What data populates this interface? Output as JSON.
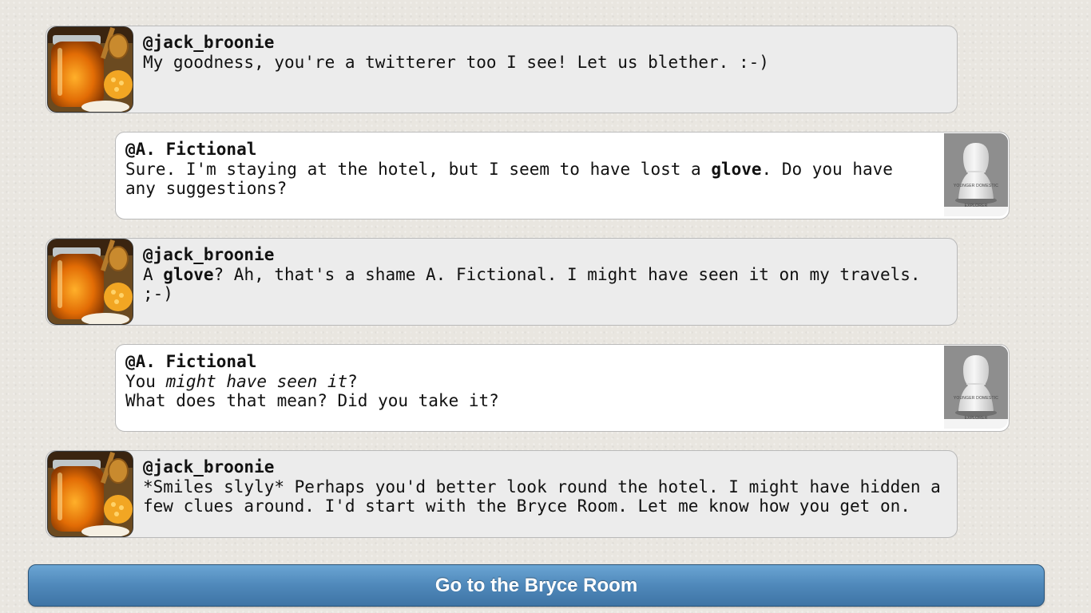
{
  "conversation": [
    {
      "role": "npc",
      "handle": "@jack_broonie",
      "avatar_icon": "honey-jar-avatar-icon",
      "lines": [
        [
          {
            "text": "My goodness, you're a twitterer too I see! Let us blether. :-)"
          }
        ]
      ]
    },
    {
      "role": "player",
      "handle": "@A. Fictional",
      "avatar_icon": "pawn-figure-avatar-icon",
      "avatar_caption": "YOUNGER DOMESTIC EXPLORER",
      "lines": [
        [
          {
            "text": "Sure. I'm staying at the hotel, but I seem to have lost a "
          },
          {
            "text": "glove",
            "style": "bold"
          },
          {
            "text": ". Do you have any suggestions?"
          }
        ]
      ]
    },
    {
      "role": "npc",
      "handle": "@jack_broonie",
      "avatar_icon": "honey-jar-avatar-icon",
      "lines": [
        [
          {
            "text": "A "
          },
          {
            "text": "glove",
            "style": "bold"
          },
          {
            "text": "? Ah, that's a shame A. Fictional. I might have seen it on my travels. ;-)"
          }
        ]
      ]
    },
    {
      "role": "player",
      "handle": "@A. Fictional",
      "avatar_icon": "pawn-figure-avatar-icon",
      "avatar_caption": "YOUNGER DOMESTIC EXPLORER",
      "lines": [
        [
          {
            "text": "You "
          },
          {
            "text": "might have seen it",
            "style": "italic"
          },
          {
            "text": "?"
          }
        ],
        [
          {
            "text": "What does that mean? Did you take it?"
          }
        ]
      ]
    },
    {
      "role": "npc",
      "handle": "@jack_broonie",
      "avatar_icon": "honey-jar-avatar-icon",
      "lines": [
        [
          {
            "text": "*Smiles slyly* Perhaps you'd better look round the hotel. I might have hidden a few clues around. I'd start with the Bryce Room. Let me know how you get on."
          }
        ]
      ]
    }
  ],
  "action_button": {
    "label": "Go to the Bryce Room"
  },
  "colors": {
    "npc_bubble": "#ececec",
    "player_bubble": "#ffffff",
    "button_top": "#6aa5d4",
    "button_bottom": "#3e74a5",
    "page_background": "#e9e6e0"
  }
}
